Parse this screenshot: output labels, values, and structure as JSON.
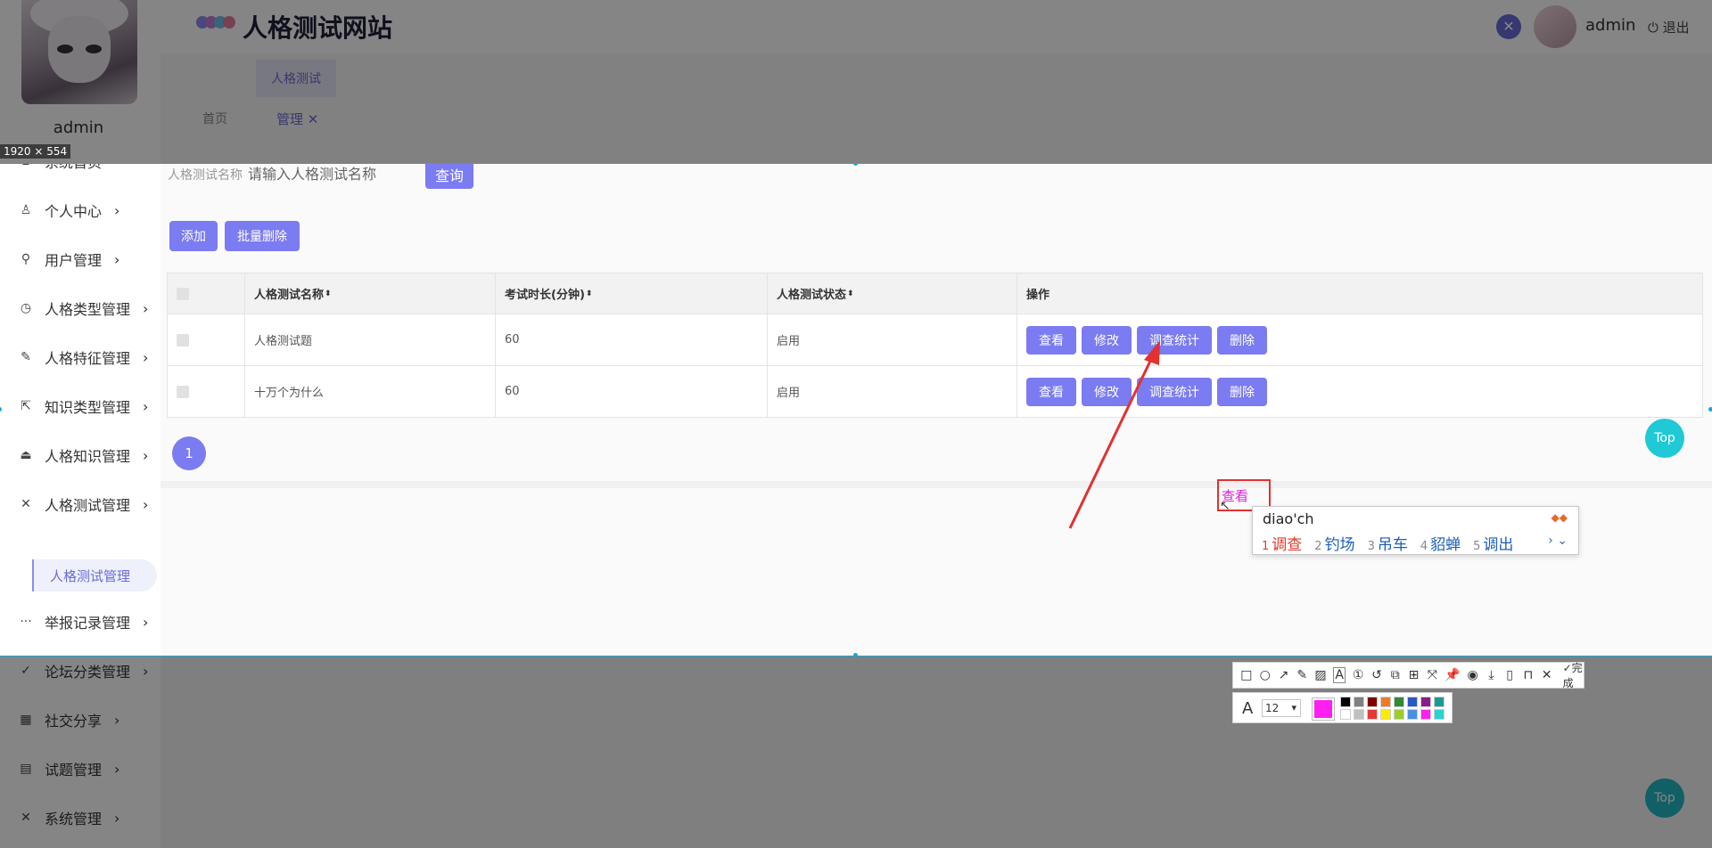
{
  "app": {
    "site_title": "人格测试网站",
    "user_name": "admin",
    "logout": "退出",
    "close_icon": "close-icon"
  },
  "sidebar": {
    "user_name": "admin",
    "items": [
      {
        "label": "系统首页",
        "icon": "home-icon"
      },
      {
        "label": "个人中心",
        "icon": "user-icon"
      },
      {
        "label": "用户管理",
        "icon": "key-icon"
      },
      {
        "label": "人格类型管理",
        "icon": "clock-icon"
      },
      {
        "label": "人格特征管理",
        "icon": "edit-icon"
      },
      {
        "label": "知识类型管理",
        "icon": "share-icon"
      },
      {
        "label": "人格知识管理",
        "icon": "stamp-icon"
      },
      {
        "label": "人格测试管理",
        "icon": "close-icon"
      },
      {
        "label": "举报记录管理",
        "icon": "more-icon"
      },
      {
        "label": "论坛分类管理",
        "icon": "check-icon"
      },
      {
        "label": "社交分享",
        "icon": "grid-icon"
      },
      {
        "label": "试题管理",
        "icon": "doc-icon"
      },
      {
        "label": "系统管理",
        "icon": "close-icon"
      }
    ],
    "sub_item": "人格测试管理"
  },
  "tabs": {
    "group": "人格测试",
    "home": "首页",
    "manage": "管理 ✕"
  },
  "capture": {
    "size_badge": "1920 × 554"
  },
  "search": {
    "label": "人格测试名称",
    "placeholder": "请输入人格测试名称",
    "query_button": "查询"
  },
  "actions": {
    "add": "添加",
    "batch_delete": "批量删除"
  },
  "table": {
    "headers": [
      "人格测试名称",
      "考试时长(分钟)",
      "人格测试状态",
      "操作"
    ],
    "rows": [
      {
        "name": "人格测试题",
        "duration": "60",
        "status": "启用"
      },
      {
        "name": "十万个为什么",
        "duration": "60",
        "status": "启用"
      }
    ],
    "row_actions": [
      "查看",
      "修改",
      "调查统计",
      "删除"
    ]
  },
  "pagination": {
    "current": "1"
  },
  "top_button": "Top",
  "annotation": {
    "text": "查看"
  },
  "ime": {
    "input": "diao'ch",
    "candidates": [
      {
        "n": "1",
        "text": "调查"
      },
      {
        "n": "2",
        "text": "钓场"
      },
      {
        "n": "3",
        "text": "吊车"
      },
      {
        "n": "4",
        "text": "貂蝉"
      },
      {
        "n": "5",
        "text": "调出"
      }
    ],
    "nav": "› ⌄"
  },
  "screenshot_toolbar": {
    "done": "完成",
    "font_size": "12",
    "current_color": "#ff1ff0",
    "palette": [
      "#000000",
      "#808080",
      "#800000",
      "#f07b26",
      "#2f8a3a",
      "#2b58c7",
      "#8a1b8a",
      "#1a9a9a",
      "#ffffff",
      "#c0c0c0",
      "#e53935",
      "#ffeb00",
      "#9acd32",
      "#4a90e2",
      "#ff1ff0",
      "#27d3d3"
    ]
  },
  "colors": {
    "accent": "#7b7bf2",
    "top_button": "#1fc9d5",
    "capture_border": "#19a7e2",
    "annotation": "#e23131"
  }
}
